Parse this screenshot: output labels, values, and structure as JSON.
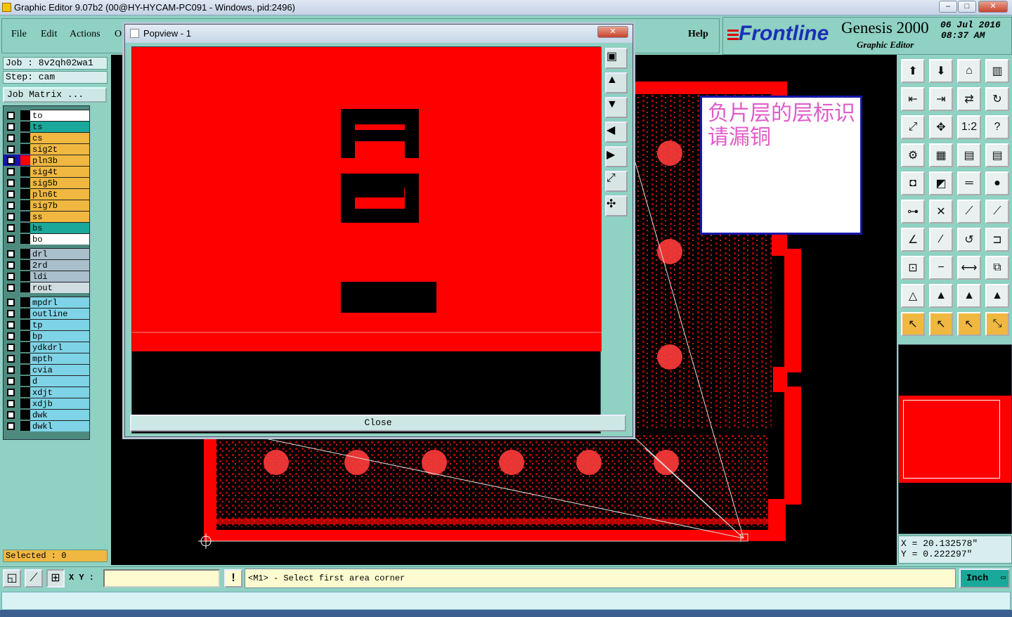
{
  "window": {
    "title": "Graphic Editor 9.07b2 (00@HY-HYCAM-PC091 - Windows, pid:2496)",
    "minimize": "–",
    "maximize": "□",
    "close": "✕"
  },
  "menu": {
    "file": "File",
    "edit": "Edit",
    "actions": "Actions",
    "options": "O",
    "help": "Help"
  },
  "brand": {
    "logo": "Frontline",
    "product": "Genesis 2000",
    "subtitle": "Graphic Editor",
    "date": "06 Jul 2016",
    "time": "08:37 AM"
  },
  "job": {
    "job_text": "Job : 8v2qh02wa1",
    "step_text": "Step: cam",
    "matrix_label": "Job Matrix ..."
  },
  "layers_group1": [
    {
      "name": "to",
      "color": "#ffffff"
    },
    {
      "name": "ts",
      "color": "#1aa89a"
    },
    {
      "name": "cs",
      "color": "#f0b840"
    },
    {
      "name": "sig2t",
      "color": "#f0b840"
    },
    {
      "name": "pln3b",
      "color": "#f0b840"
    },
    {
      "name": "sig4t",
      "color": "#f0b840"
    },
    {
      "name": "sig5b",
      "color": "#f0b840"
    },
    {
      "name": "pln6t",
      "color": "#f0b840"
    },
    {
      "name": "sig7b",
      "color": "#f0b840"
    },
    {
      "name": "ss",
      "color": "#f0b840"
    },
    {
      "name": "bs",
      "color": "#1aa89a"
    },
    {
      "name": "bo",
      "color": "#ffffff"
    }
  ],
  "layers_group2": [
    {
      "name": "drl",
      "color": "#a9bfcc"
    },
    {
      "name": "2rd",
      "color": "#a9bfcc"
    },
    {
      "name": "ldi",
      "color": "#a9bfcc"
    },
    {
      "name": "rout",
      "color": "#d0dde0"
    }
  ],
  "layers_group3": [
    {
      "name": "mpdrl",
      "color": "#7fd3e6"
    },
    {
      "name": "outline",
      "color": "#7fd3e6"
    },
    {
      "name": "tp",
      "color": "#7fd3e6"
    },
    {
      "name": "bp",
      "color": "#7fd3e6"
    },
    {
      "name": "ydkdrl",
      "color": "#7fd3e6"
    },
    {
      "name": "mpth",
      "color": "#7fd3e6"
    },
    {
      "name": "cvia",
      "color": "#7fd3e6"
    },
    {
      "name": "d",
      "color": "#7fd3e6"
    },
    {
      "name": "xdjt",
      "color": "#7fd3e6"
    },
    {
      "name": "xdjb",
      "color": "#7fd3e6"
    },
    {
      "name": "dwk",
      "color": "#7fd3e6"
    },
    {
      "name": "dwkl",
      "color": "#7fd3e6"
    }
  ],
  "selected_text": "Selected : 0",
  "popview": {
    "title": "Popview - 1",
    "close_label": "Close"
  },
  "note_text": "负片层的层标识请漏铜",
  "coords": {
    "x_text": "X = 20.132578\"",
    "y_text": "Y = 0.222297\""
  },
  "bottom": {
    "xy_label": "X Y :",
    "xy_value": "",
    "alert": "!",
    "prompt": "<M1> - Select first area corner",
    "units": "Inch"
  },
  "colors": {
    "panel": "#8fd1c2",
    "board": "#ff0000",
    "active_layer": "#ff0000"
  }
}
